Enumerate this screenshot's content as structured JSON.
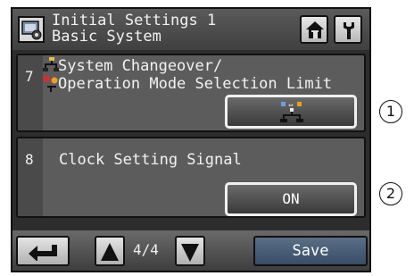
{
  "header": {
    "title_line1": "Initial Settings 1",
    "title_line2": "Basic System",
    "icons": {
      "settings": "settings-panel-icon",
      "home": "home-icon",
      "tools": "wrench-icon"
    }
  },
  "items": [
    {
      "number": "7",
      "label_line1": "System Changeover/",
      "label_line2": "Operation Mode Selection Limit",
      "value_icon": "system-changeover-icon"
    },
    {
      "number": "8",
      "label": "Clock Setting Signal",
      "value": "ON"
    }
  ],
  "footer": {
    "page": "4/4",
    "save_label": "Save",
    "icons": {
      "back": "return-arrow-icon",
      "up": "triangle-up-icon",
      "down": "triangle-down-icon"
    }
  },
  "callouts": [
    "1",
    "2"
  ]
}
